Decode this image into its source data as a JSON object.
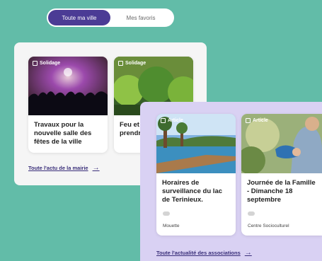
{
  "toggle": {
    "active_label": "Toute ma ville",
    "inactive_label": "Mes favoris"
  },
  "news": {
    "cards": [
      {
        "tag": "Solidage",
        "title": "Travaux pour la nouvelle salle des fêtes de la ville"
      },
      {
        "tag": "Solidage",
        "title": "Feu et quels n prendr"
      }
    ],
    "link_label": "Toute l'actu de la mairie"
  },
  "associations": {
    "cards": [
      {
        "tag": "Article",
        "title": "Horaires de surveillance du lac de Terinieux.",
        "footer": "Mouette"
      },
      {
        "tag": "Article",
        "title": "Journée de la Famille - Dimanche 18 septembre",
        "footer": "Centre Socioculturel"
      }
    ],
    "link_label": "Toute l'actualité des associations"
  },
  "colors": {
    "background": "#62bca8",
    "accent": "#4b3b95",
    "assoc_panel": "#d9d1f3"
  }
}
